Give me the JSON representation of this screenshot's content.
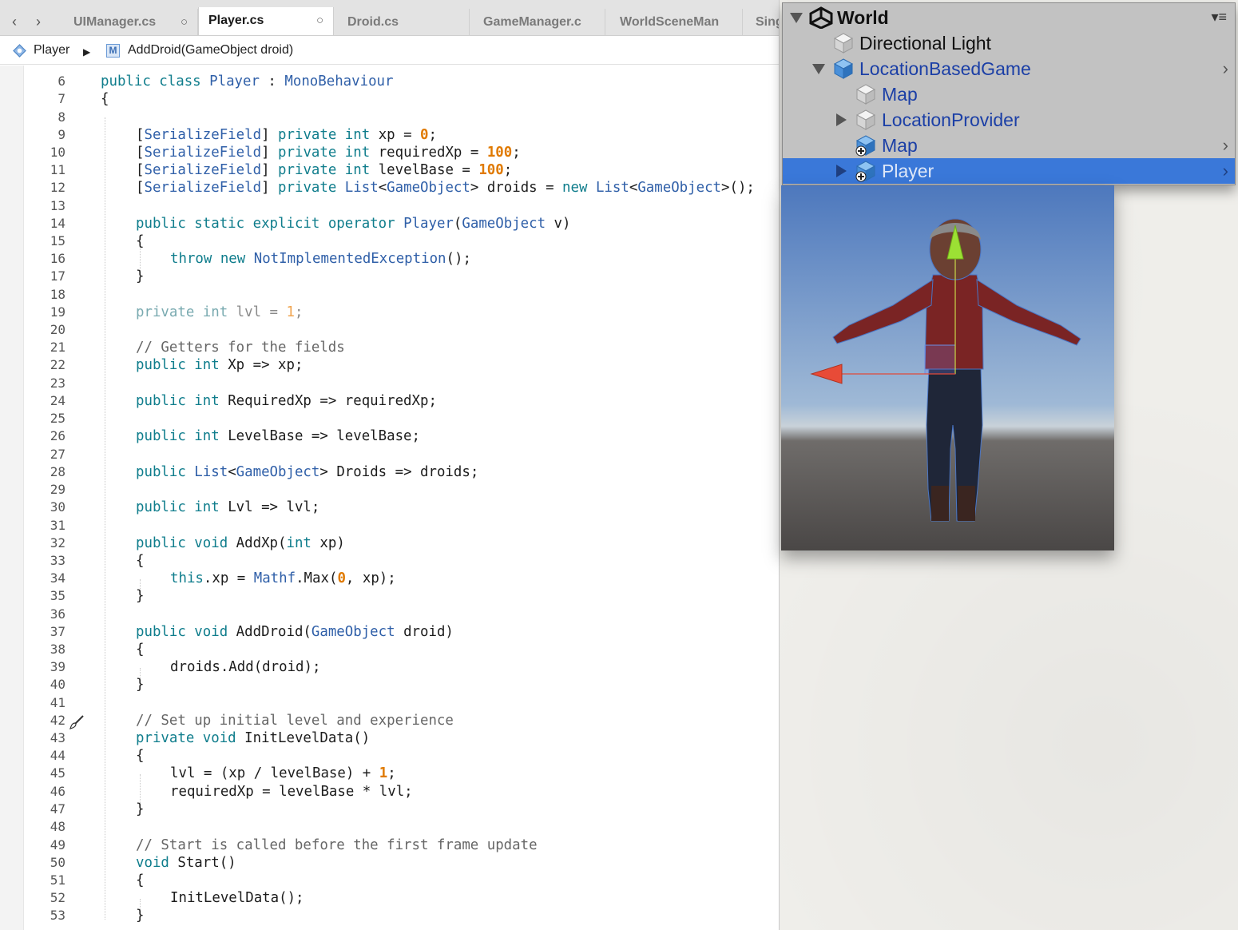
{
  "editor": {
    "nav": {
      "back": "‹",
      "forward": "›"
    },
    "tabs": [
      {
        "label": "UIManager.cs",
        "active": false,
        "close": "○"
      },
      {
        "label": "Player.cs",
        "active": true,
        "close": "○"
      },
      {
        "label": "Droid.cs",
        "active": false
      },
      {
        "label": "GameManager.c",
        "active": false
      },
      {
        "label": "WorldSceneMan",
        "active": false
      },
      {
        "label": "Sing",
        "active": false
      }
    ],
    "breadcrumb": {
      "class_name": "Player",
      "separator": "▶",
      "method_badge": "M",
      "method": "AddDroid(GameObject droid)"
    },
    "line_numbers": [
      "6",
      "7",
      "8",
      "9",
      "10",
      "11",
      "12",
      "13",
      "14",
      "15",
      "16",
      "17",
      "18",
      "19",
      "20",
      "21",
      "22",
      "23",
      "24",
      "25",
      "26",
      "27",
      "28",
      "29",
      "30",
      "31",
      "32",
      "33",
      "34",
      "35",
      "36",
      "37",
      "38",
      "39",
      "40",
      "41",
      "42",
      "43",
      "44",
      "45",
      "46",
      "47",
      "48",
      "49",
      "50",
      "51",
      "52",
      "53"
    ],
    "code": {
      "l6": [
        "public ",
        "class ",
        "Player",
        " : ",
        "MonoBehaviour"
      ],
      "l7": [
        "{"
      ],
      "l9": [
        "[",
        "SerializeField",
        "] ",
        "private ",
        "int ",
        "xp = ",
        "0",
        ";"
      ],
      "l10": [
        "[",
        "SerializeField",
        "] ",
        "private ",
        "int ",
        "requiredXp = ",
        "100",
        ";"
      ],
      "l11": [
        "[",
        "SerializeField",
        "] ",
        "private ",
        "int ",
        "levelBase = ",
        "100",
        ";"
      ],
      "l12": [
        "[",
        "SerializeField",
        "] ",
        "private ",
        "List",
        "<",
        "GameObject",
        "> droids = ",
        "new ",
        "List",
        "<",
        "GameObject",
        ">();"
      ],
      "l14": [
        "public ",
        "static ",
        "explicit ",
        "operator ",
        "Player",
        "(",
        "GameObject",
        " v)"
      ],
      "l15": [
        "{"
      ],
      "l16": [
        "throw ",
        "new ",
        "NotImplementedException",
        "();"
      ],
      "l17": [
        "}"
      ],
      "l19": [
        "private ",
        "int ",
        "lvl = ",
        "1",
        ";"
      ],
      "l21": [
        "// Getters for the fields"
      ],
      "l22": [
        "public ",
        "int ",
        "Xp => xp;"
      ],
      "l24": [
        "public ",
        "int ",
        "RequiredXp => requiredXp;"
      ],
      "l26": [
        "public ",
        "int ",
        "LevelBase => levelBase;"
      ],
      "l28": [
        "public ",
        "List",
        "<",
        "GameObject",
        "> Droids => droids;"
      ],
      "l30": [
        "public ",
        "int ",
        "Lvl => lvl;"
      ],
      "l32": [
        "public ",
        "void ",
        "AddXp(",
        "int ",
        "xp)"
      ],
      "l33": [
        "{"
      ],
      "l34": [
        "this",
        ".xp = ",
        "Mathf",
        ".Max(",
        "0",
        ", xp);"
      ],
      "l35": [
        "}"
      ],
      "l37": [
        "public ",
        "void ",
        "AddDroid(",
        "GameObject",
        " droid)"
      ],
      "l38": [
        "{"
      ],
      "l39": [
        "droids.Add(droid);"
      ],
      "l40": [
        "}"
      ],
      "l42": [
        "// Set up initial level and experience"
      ],
      "l43": [
        "private ",
        "void ",
        "InitLevelData()"
      ],
      "l44": [
        "{"
      ],
      "l45": [
        "lvl = (xp / levelBase) + ",
        "1",
        ";"
      ],
      "l46": [
        "requiredXp = levelBase * lvl;"
      ],
      "l47": [
        "}"
      ],
      "l49": [
        "// Start is called before the first frame update"
      ],
      "l50": [
        "void ",
        "Start()"
      ],
      "l51": [
        "{"
      ],
      "l52": [
        "InitLevelData();"
      ],
      "l53": [
        "}"
      ]
    }
  },
  "hierarchy": {
    "scene_name": "World",
    "menu": "▾≡",
    "items": [
      {
        "label": "Directional Light"
      },
      {
        "label": "LocationBasedGame",
        "chevron": "›"
      },
      {
        "label": "Map"
      },
      {
        "label": "LocationProvider"
      },
      {
        "label": "Map",
        "chevron": "›"
      },
      {
        "label": "Player",
        "selected": true,
        "chevron": "›"
      }
    ]
  },
  "colors": {
    "keyword": "#0f7d8c",
    "type": "#2f5fa8",
    "number": "#e07a00",
    "comment": "#666666",
    "selection": "#3a78d9",
    "hierarchy_bg": "#c2c2c2"
  }
}
